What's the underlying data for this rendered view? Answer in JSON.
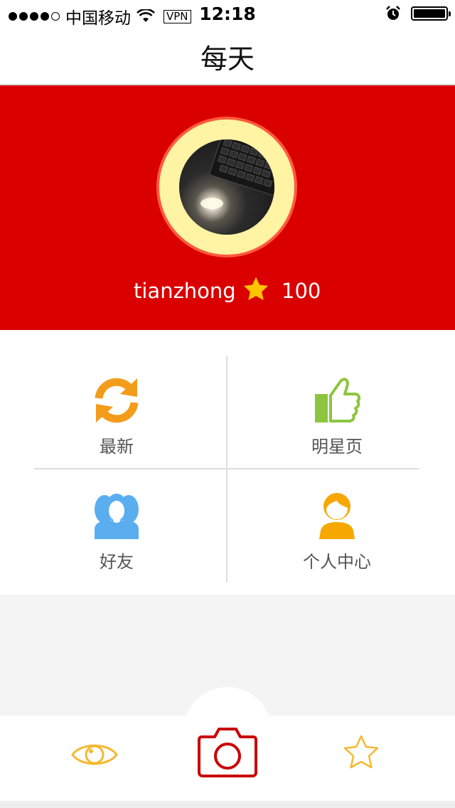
{
  "status_bar": {
    "carrier": "中国移动",
    "vpn": "VPN",
    "time": "12:18",
    "icons": [
      "signal-dots",
      "wifi-icon",
      "alarm-icon",
      "battery-icon"
    ]
  },
  "nav": {
    "title": "每天"
  },
  "profile": {
    "username": "tianzhong",
    "points": "100",
    "star_color": "#ffc400"
  },
  "menu": [
    {
      "label": "最新",
      "icon": "refresh-icon",
      "color": "#f39c1b"
    },
    {
      "label": "明星页",
      "icon": "thumbs-up-icon",
      "color": "#8cc63f"
    },
    {
      "label": "好友",
      "icon": "friends-icon",
      "color": "#5aaef0"
    },
    {
      "label": "个人中心",
      "icon": "person-icon",
      "color": "#f7a800"
    }
  ],
  "tabbar": {
    "items": [
      {
        "icon": "eye-icon",
        "color": "#f5b92f"
      },
      {
        "icon": "camera-icon",
        "color": "#c90000"
      },
      {
        "icon": "star-outline-icon",
        "color": "#f5b92f"
      }
    ]
  },
  "colors": {
    "banner": "#db0000",
    "ring": "#fff3a4",
    "ring_border": "#ff5a3c"
  }
}
